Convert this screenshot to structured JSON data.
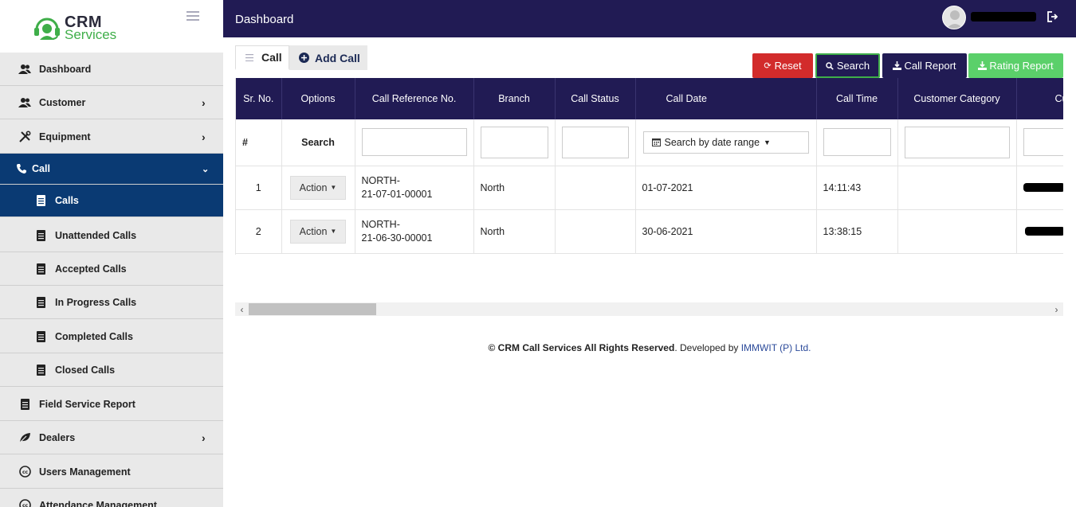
{
  "app": {
    "logo_title": "CRM",
    "logo_subtitle": "Services"
  },
  "topbar": {
    "title": "Dashboard"
  },
  "sidebar": {
    "items": [
      {
        "label": "Dashboard",
        "icon": "users-icon"
      },
      {
        "label": "Customer",
        "icon": "users-icon"
      },
      {
        "label": "Equipment",
        "icon": "tools-icon"
      },
      {
        "label": "Call",
        "icon": "phone-icon"
      },
      {
        "label": "Calls",
        "icon": "file-icon"
      },
      {
        "label": "Unattended Calls",
        "icon": "file-icon"
      },
      {
        "label": "Accepted Calls",
        "icon": "file-icon"
      },
      {
        "label": "In Progress Calls",
        "icon": "file-icon"
      },
      {
        "label": "Completed Calls",
        "icon": "file-icon"
      },
      {
        "label": "Closed Calls",
        "icon": "file-icon"
      },
      {
        "label": "Field Service Report",
        "icon": "file-icon"
      },
      {
        "label": "Dealers",
        "icon": "leaf-icon"
      },
      {
        "label": "Users Management",
        "icon": "cc-icon"
      },
      {
        "label": "Attendance Management",
        "icon": "cc-icon"
      }
    ],
    "active_item": "Calls"
  },
  "tabs": {
    "call": "Call",
    "add_call": "Add Call"
  },
  "buttons": {
    "reset": "Reset",
    "search": "Search",
    "call_report": "Call Report",
    "rating_report": "Rating Report"
  },
  "table": {
    "columns": [
      "Sr. No.",
      "Options",
      "Call Reference No.",
      "Branch",
      "Call Status",
      "Call Date",
      "Call Time",
      "Customer Category",
      "Cu"
    ],
    "filter_row": {
      "hash": "#",
      "search": "Search",
      "date_placeholder": "Search by date range"
    },
    "action_label": "Action",
    "rows": [
      {
        "sr": "1",
        "ref_line1": "NORTH-",
        "ref_line2": "21-07-01-00001",
        "branch": "North",
        "status": "",
        "date": "01-07-2021",
        "time": "14:11:43",
        "category": ""
      },
      {
        "sr": "2",
        "ref_line1": "NORTH-",
        "ref_line2": "21-06-30-00001",
        "branch": "North",
        "status": "",
        "date": "30-06-2021",
        "time": "13:38:15",
        "category": ""
      }
    ]
  },
  "footer": {
    "copyright": "© CRM Call Services All Rights Reserved",
    "developed_by": ". Developed by ",
    "company": "IMMWIT (P) Ltd."
  },
  "colors": {
    "navy": "#211b54",
    "active_nav": "#0a3a73",
    "reset": "#d22b2b",
    "rating": "#5bd06a",
    "brand_green": "#3fae49"
  }
}
